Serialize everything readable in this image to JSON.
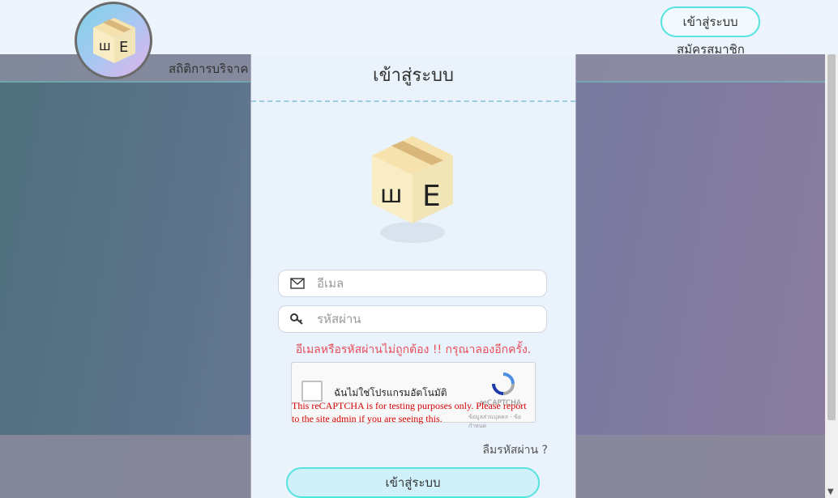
{
  "header": {
    "login_button": "เข้าสู่ระบบ",
    "register_link": "สมัครสมาชิก",
    "nav_donation": "สถิติการบริจาค"
  },
  "modal": {
    "title": "เข้าสู่ระบบ",
    "email_placeholder": "อีเมล",
    "password_placeholder": "รหัสผ่าน",
    "error_message": "อีเมลหรือรหัสผ่านไม่ถูกต้อง !! กรุณาลองอีกครั้ง.",
    "forgot_password": "ลืมรหัสผ่าน ?",
    "submit_button": "เข้าสู่ระบบ"
  },
  "captcha": {
    "label": "ฉันไม่ใช่โปรแกรมอัตโนมัติ",
    "brand": "reCAPTCHA",
    "privacy": "ข้อมูลส่วนบุคคล - ข้อกำหนด",
    "warning": "This reCAPTCHA is for testing purposes only. Please report to the site admin if you are seeing this."
  },
  "colors": {
    "accent_border": "#55e3e0",
    "error": "#e8505a",
    "modal_bg": "#eaf2fc"
  },
  "icons": {
    "email": "envelope-icon",
    "password": "key-icon",
    "logo": "box-logo-icon"
  }
}
